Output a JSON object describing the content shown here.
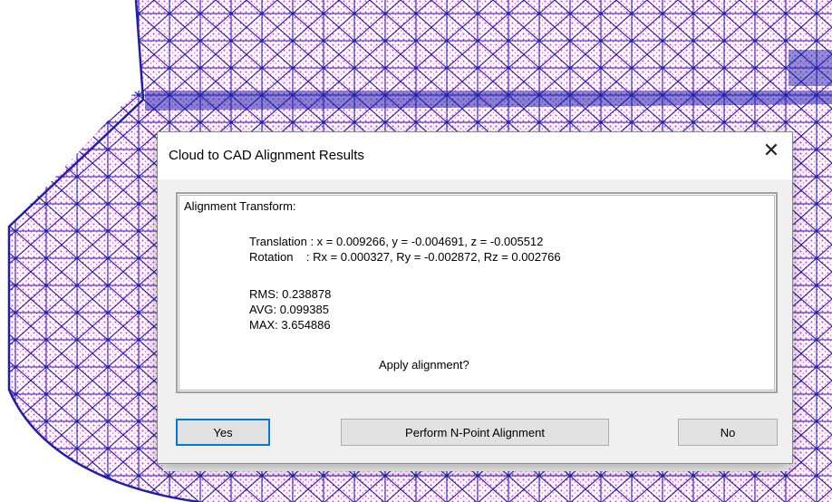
{
  "dialog": {
    "title": "Cloud to CAD Alignment Results",
    "close_glyph": "✕"
  },
  "results": {
    "header": "Alignment Transform:",
    "translation": "Translation : x = 0.009266, y = -0.004691, z = -0.005512",
    "rotation": "Rotation    : Rx = 0.000327, Ry = -0.002872, Rz = 0.002766",
    "rms": "RMS: 0.238878",
    "avg": "AVG: 0.099385",
    "max": "MAX: 3.654886",
    "question": "Apply alignment?"
  },
  "buttons": {
    "yes": "Yes",
    "npoint": "Perform N-Point Alignment",
    "no": "No"
  },
  "colors": {
    "mesh_blue": "#1f1fa8",
    "point_magenta": "#ff00ff",
    "accent_focus": "#0078d7"
  }
}
